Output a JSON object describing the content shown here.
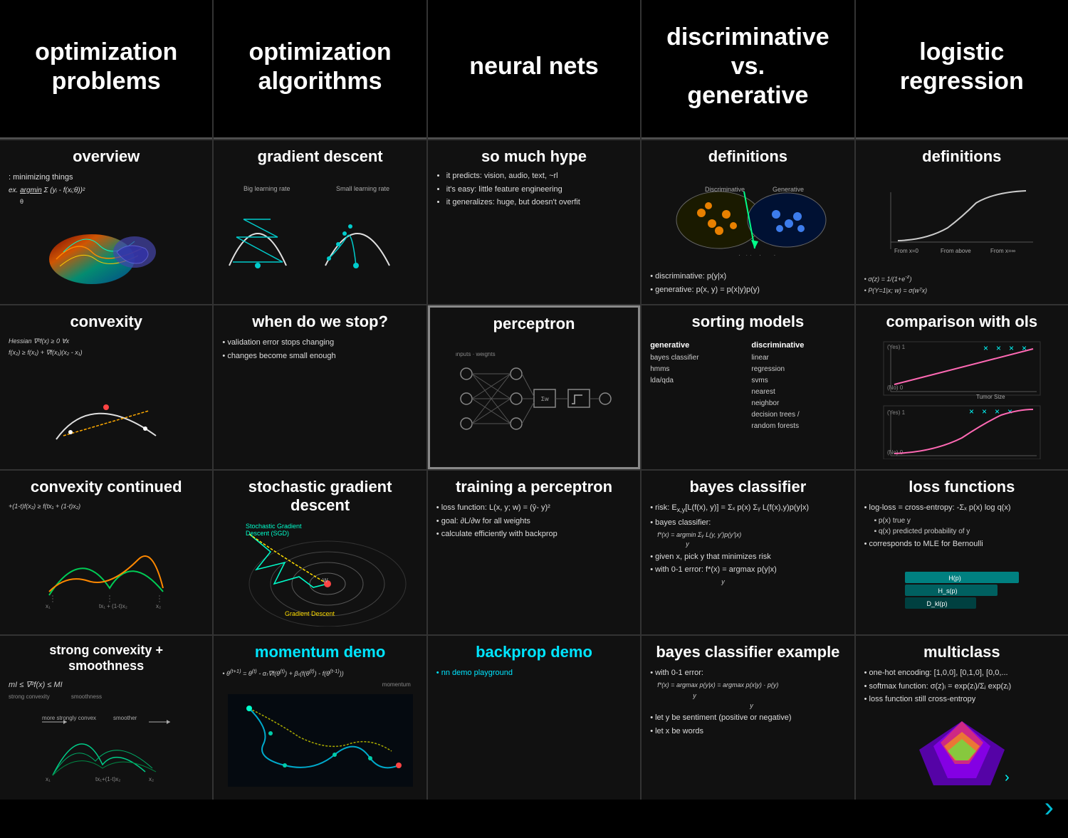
{
  "header": {
    "col1_title": "optimization\nproblems",
    "col2_title": "optimization\nalgorithms",
    "col3_title": "neural nets",
    "col4_title": "discriminative vs.\ngenerative",
    "col5_title": "logistic regression"
  },
  "row2": {
    "c1_title": "overview",
    "c1_body": [
      ": minimizing things",
      "ex. argmin Σ(yi - f(xi;θ))²"
    ],
    "c2_title": "gradient descent",
    "c2_sub": "Big learning rate    Small learning rate",
    "c3_title": "so much hype",
    "c3_bullets": [
      "it predicts: vision, audio, text, ~rl",
      "it's easy: little feature engineering",
      "it generalizes: huge, but doesn't overfit"
    ],
    "c4_title": "definitions",
    "c4_bullets": [
      "discriminative: p(y|x)",
      "generative: p(x, y) = p(x|y)p(y)"
    ],
    "c5_title": "definitions",
    "c5_body": [
      "σ(z) = 1/(1+e^-z)",
      "P(Y=1|x; w) = σ(wᵀx)"
    ]
  },
  "row3": {
    "c1_title": "convexity",
    "c1_body": [
      "Hessian ∇²f(x) ≥ 0 ∀x",
      "f(x₂) ≥ f(x₁) + ∇f(x₁)(x₂ - x₁)"
    ],
    "c2_title": "when do we stop?",
    "c2_bullets": [
      "validation error stops changing",
      "changes become small enough"
    ],
    "c3_title": "perceptron",
    "c4_title": "sorting models",
    "c4_gen": [
      "bayes classifier",
      "hmms",
      "lda/qda"
    ],
    "c4_disc": [
      "linear",
      "regression",
      "svms",
      "nearest",
      "neighbor",
      "decision trees /",
      "random forests"
    ],
    "c5_title": "comparison with ols"
  },
  "row4": {
    "c1_title": "convexity continued",
    "c1_formula": "(1-t)f(x₂) ≥ f(tx₁ + (1-t)x₂)",
    "c2_title": "stochastic gradient descent",
    "c3_title": "training a perceptron",
    "c3_bullets": [
      "loss function: L(x, y; w) = (yˆ- y)²",
      "goal: ∂L/∂w for all weights",
      "calculate efficiently with backprop"
    ],
    "c4_title": "bayes classifier",
    "c4_bullets": [
      "risk: E_{x,y}[L(f(x), y)] = Σₓ p(x) Σᵧ L(f(x),y)p(y|x)",
      "bayes classifier:",
      "f*(x) = argmin Σᵧ L(y, y')p(y'|x)",
      "given x, pick y that minimizes risk",
      "with 0-1 error: f*(x) = argmax p(y|x)"
    ],
    "c5_title": "loss functions",
    "c5_bullets": [
      "log-loss = cross-entropy: -Σₓ p(x) log q(x)",
      "p(x) true y",
      "q(x) predicted probability of y",
      "corresponds to MLE for Bernoulli"
    ]
  },
  "row5": {
    "c1_title": "strong convexity +\nsmoothness",
    "c1_formula": "mI ≤ ∇²f(x) ≤ MI",
    "c1_sub1": "strong convexity",
    "c1_sub2": "smoothness",
    "c2_title": "momentum demo",
    "c2_formula": "θ^(t+1) = θ^(t) - αₜ∇f(θ^(t)) + βₜ(f(θ^(t)) - f(θ^(t-1)))",
    "c2_sub": "momentum",
    "c3_title": "backprop demo",
    "c3_link": "nn demo playground",
    "c4_title": "bayes classifier example",
    "c4_bullets": [
      "with 0-1 error:",
      "f*(x) = argmax p(y|x) = argmax p(x|y) · p(y)",
      "let y be sentiment (positive or negative)",
      "let x be words"
    ],
    "c5_title": "multiclass",
    "c5_bullets": [
      "one-hot encoding: [1,0,0], [0,1,0], [0,0,...",
      "softmax function: σ(z)ᵢ = exp(zᵢ)/Σⱼ exp(zⱼ)",
      "loss function still cross-entropy"
    ]
  },
  "icons": {
    "next_arrow": "›"
  }
}
